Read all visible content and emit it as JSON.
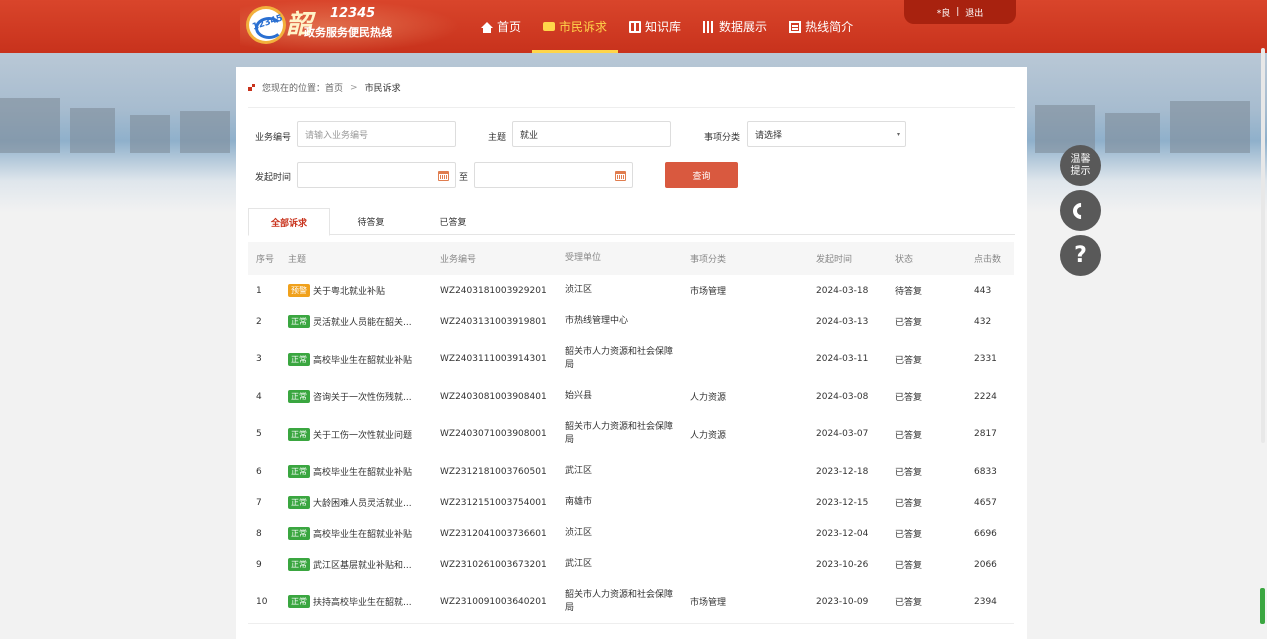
{
  "header": {
    "logo_glyph": "韶",
    "logo_code": "12345",
    "logo_number": "12345",
    "logo_subtitle": "政务服务便民热线",
    "nav": [
      {
        "label": "首页",
        "icon": "home-icon"
      },
      {
        "label": "市民诉求",
        "icon": "chat-icon",
        "active": true
      },
      {
        "label": "知识库",
        "icon": "book-icon"
      },
      {
        "label": "数据展示",
        "icon": "bar-chart-icon"
      },
      {
        "label": "热线简介",
        "icon": "document-icon"
      }
    ],
    "user": {
      "name": "*良",
      "separator": "|",
      "logout": "退出"
    }
  },
  "breadcrumb": {
    "prefix": "您现在的位置：首页",
    "separator": ">",
    "current": "市民诉求"
  },
  "filters": {
    "business_no_label": "业务编号",
    "business_no_placeholder": "请输入业务编号",
    "subject_label": "主题",
    "subject_value": "就业",
    "category_label": "事项分类",
    "category_value": "请选择",
    "start_time_label": "发起时间",
    "to_label": "至",
    "query_button": "查询"
  },
  "tabs": [
    {
      "label": "全部诉求",
      "active": true
    },
    {
      "label": "待答复"
    },
    {
      "label": "已答复"
    }
  ],
  "table": {
    "headers": [
      "序号",
      "主题",
      "业务编号",
      "受理单位",
      "事项分类",
      "发起时间",
      "状态",
      "点击数"
    ],
    "rows": [
      {
        "idx": "1",
        "tag": "预警",
        "tag_type": "warn",
        "subject": "关于粤北就业补贴",
        "no": "WZ2403181003929201",
        "unit": "浈江区",
        "category": "市场管理",
        "date": "2024-03-18",
        "status": "待答复",
        "hits": "443"
      },
      {
        "idx": "2",
        "tag": "正常",
        "tag_type": "ok",
        "subject": "灵活就业人员能在韶关...",
        "no": "WZ2403131003919801",
        "unit": "市热线管理中心",
        "category": "",
        "date": "2024-03-13",
        "status": "已答复",
        "hits": "432"
      },
      {
        "idx": "3",
        "tag": "正常",
        "tag_type": "ok",
        "subject": "高校毕业生在韶就业补贴",
        "no": "WZ2403111003914301",
        "unit": "韶关市人力资源和社会保障局",
        "category": "",
        "date": "2024-03-11",
        "status": "已答复",
        "hits": "2331"
      },
      {
        "idx": "4",
        "tag": "正常",
        "tag_type": "ok",
        "subject": "咨询关于一次性伤残就...",
        "no": "WZ2403081003908401",
        "unit": "始兴县",
        "category": "人力资源",
        "date": "2024-03-08",
        "status": "已答复",
        "hits": "2224"
      },
      {
        "idx": "5",
        "tag": "正常",
        "tag_type": "ok",
        "subject": "关于工伤一次性就业问题",
        "no": "WZ2403071003908001",
        "unit": "韶关市人力资源和社会保障局",
        "category": "人力资源",
        "date": "2024-03-07",
        "status": "已答复",
        "hits": "2817"
      },
      {
        "idx": "6",
        "tag": "正常",
        "tag_type": "ok",
        "subject": "高校毕业生在韶就业补贴",
        "no": "WZ2312181003760501",
        "unit": "武江区",
        "category": "",
        "date": "2023-12-18",
        "status": "已答复",
        "hits": "6833"
      },
      {
        "idx": "7",
        "tag": "正常",
        "tag_type": "ok",
        "subject": "大龄困难人员灵活就业...",
        "no": "WZ2312151003754001",
        "unit": "南雄市",
        "category": "",
        "date": "2023-12-15",
        "status": "已答复",
        "hits": "4657"
      },
      {
        "idx": "8",
        "tag": "正常",
        "tag_type": "ok",
        "subject": "高校毕业生在韶就业补贴",
        "no": "WZ2312041003736601",
        "unit": "浈江区",
        "category": "",
        "date": "2023-12-04",
        "status": "已答复",
        "hits": "6696"
      },
      {
        "idx": "9",
        "tag": "正常",
        "tag_type": "ok",
        "subject": "武江区基层就业补贴和...",
        "no": "WZ2310261003673201",
        "unit": "武江区",
        "category": "",
        "date": "2023-10-26",
        "status": "已答复",
        "hits": "2066"
      },
      {
        "idx": "10",
        "tag": "正常",
        "tag_type": "ok",
        "subject": "扶持高校毕业生在韶就...",
        "no": "WZ2310091003640201",
        "unit": "韶关市人力资源和社会保障局",
        "category": "市场管理",
        "date": "2023-10-09",
        "status": "已答复",
        "hits": "2394"
      }
    ]
  },
  "side_buttons": {
    "tips_line1": "温馨",
    "tips_line2": "提示",
    "help_glyph": "?"
  }
}
